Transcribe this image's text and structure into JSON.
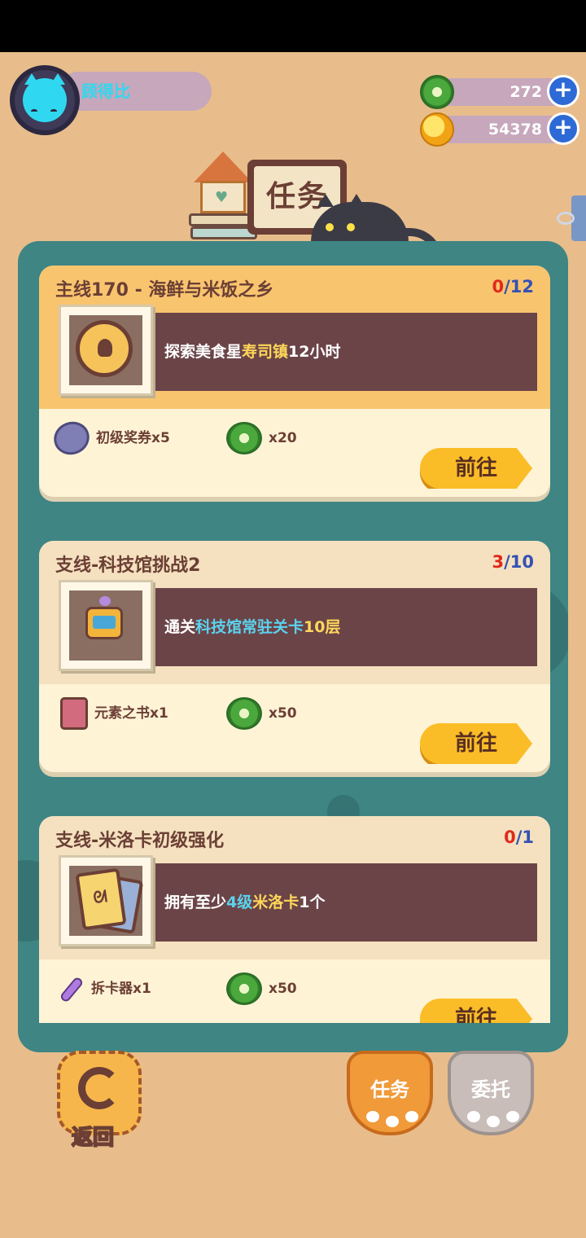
{
  "player": {
    "name": "顾得比"
  },
  "currencies": {
    "donut": "272",
    "planet": "54378",
    "plus": "+"
  },
  "header": {
    "title": "任务"
  },
  "quests": [
    {
      "title": "主线170 - 海鲜与米饭之乡",
      "progress_current": "0",
      "progress_total": "/12",
      "desc_a": "探索美食星",
      "desc_hl": "寿司镇",
      "desc_b": "12小时",
      "reward1": "初级奖券x5",
      "reward2": "x20",
      "action": "前往"
    },
    {
      "title": "支线-科技馆挑战2",
      "progress_current": "3",
      "progress_total": "/10",
      "desc_a": "通关",
      "desc_hl": "科技馆常驻关卡",
      "desc_b": "10层",
      "reward1": "元素之书x1",
      "reward2": "x50",
      "action": "前往"
    },
    {
      "title": "支线-米洛卡初级强化",
      "progress_current": "0",
      "progress_total": "/1",
      "desc_a": "拥有至少",
      "desc_hl": "4级",
      "desc_hl2": "米洛卡",
      "desc_b": "1个",
      "reward1": "拆卡器x1",
      "reward2": "x50",
      "action": "前往"
    }
  ],
  "bottom": {
    "back": "返回",
    "tab_tasks": "任务",
    "tab_commission": "委托"
  },
  "colors": {
    "background": "#e8bd8b",
    "panel": "#3e8584",
    "main_header": "#f9c46e",
    "desc_bar": "#6b4448",
    "go_button": "#fbbd27"
  }
}
